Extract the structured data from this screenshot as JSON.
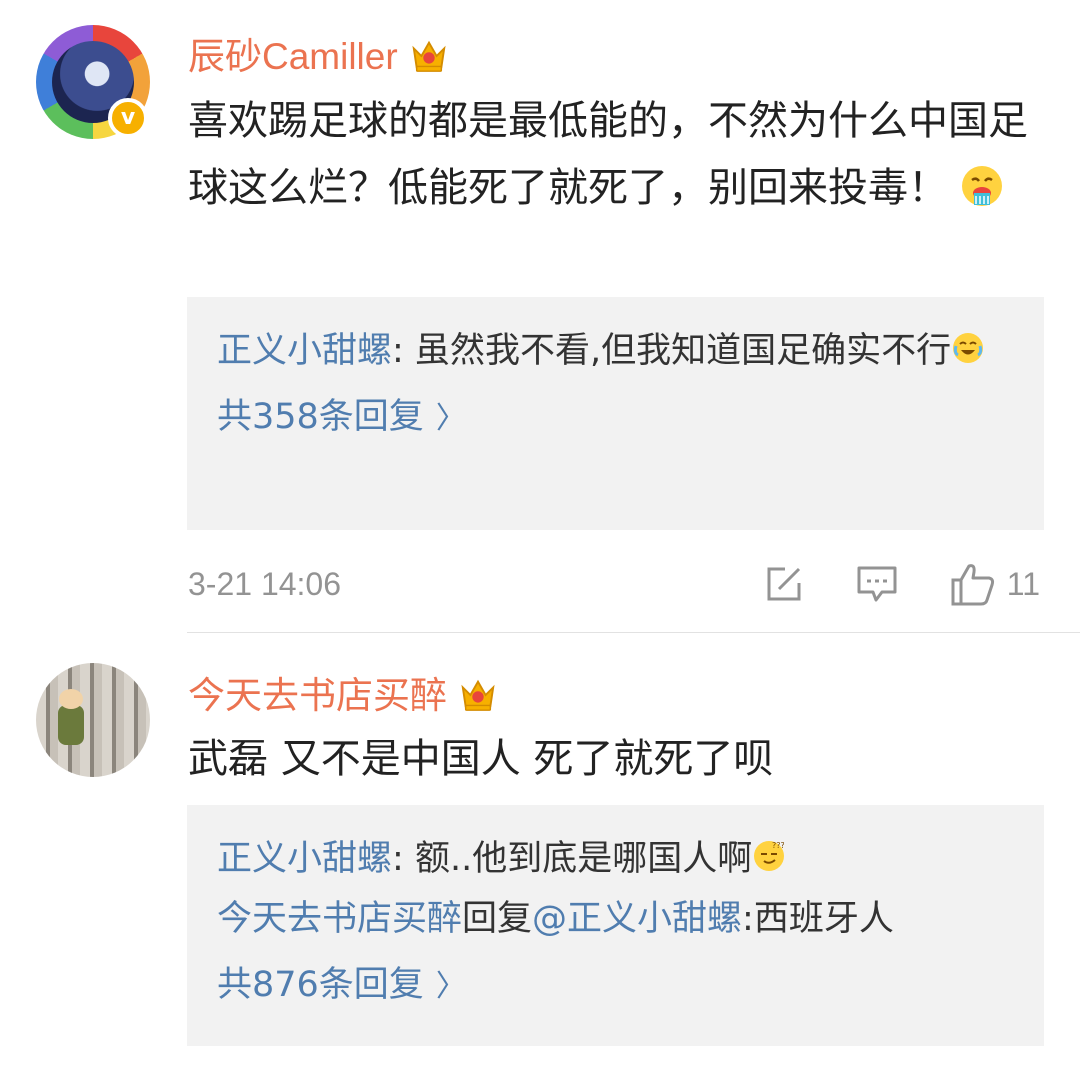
{
  "comments": [
    {
      "username": "辰砂Camiller",
      "text": "喜欢踢足球的都是最低能的，不然为什么中国足球这么烂？低能死了就死了，别回来投毒！",
      "verified_badge": "v",
      "emoji": "vomiting-face-emoji",
      "replies": [
        {
          "user": "正义小甜螺",
          "sep": ": ",
          "text": "虽然我不看,但我知道国足确实不行"
        }
      ],
      "more_replies": "共358条回复",
      "timestamp": "3-21 14:06",
      "like_count": "11"
    },
    {
      "username": "今天去书店买醉",
      "text": "武磊 又不是中国人 死了就死了呗",
      "replies": [
        {
          "user": "正义小甜螺",
          "sep": ": ",
          "text": "额..他到底是哪国人啊"
        },
        {
          "user": "今天去书店买醉",
          "mid": "回复",
          "at": "@正义小甜螺",
          "sep": ":",
          "text": "西班牙人"
        }
      ],
      "more_replies": "共876条回复"
    }
  ],
  "colors": {
    "username": "#eb7350",
    "link": "#507daf",
    "reply_bg": "#f2f2f2",
    "meta": "#939393",
    "crown": "#f7b000"
  },
  "icons": [
    "crown-icon",
    "edit-icon",
    "comment-icon",
    "like-icon",
    "chevron-right-icon"
  ]
}
